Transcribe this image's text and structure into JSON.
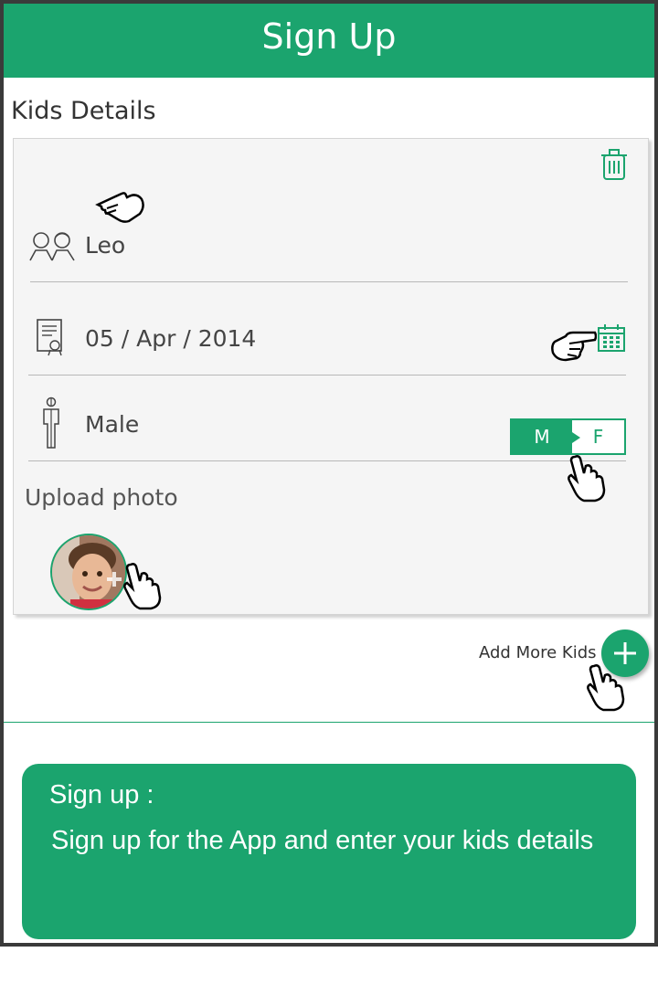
{
  "header": {
    "title": "Sign Up"
  },
  "kids_section": {
    "title": "Kids Details",
    "card": {
      "name_value": "Leo",
      "dob_value": "05 / Apr / 2014",
      "gender_value": "Male",
      "gender_toggle": {
        "m_label": "M",
        "f_label": "F",
        "selected": "M"
      },
      "upload_label": "Upload photo"
    },
    "add_more_label": "Add More Kids"
  },
  "info_box": {
    "title": "Sign up :",
    "body": "Sign up for the App and enter your kids details"
  },
  "colors": {
    "accent": "#1ba46e",
    "card_bg": "#f5f5f5",
    "text": "#444444"
  },
  "icons": [
    "trash-icon",
    "kids-icon",
    "certificate-icon",
    "calendar-icon",
    "gender-icon",
    "plus-icon",
    "hand-pointer-icon"
  ]
}
